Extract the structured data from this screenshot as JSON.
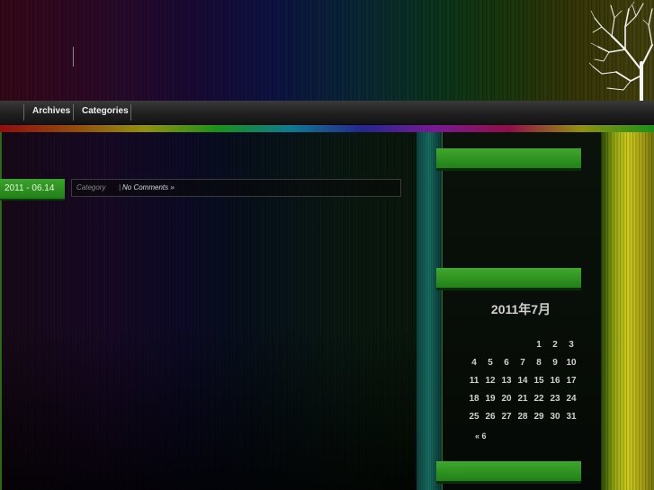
{
  "nav": {
    "archives": "Archives",
    "categories": "Categories"
  },
  "post": {
    "date": "2011 - 06.14",
    "category_label": "Category",
    "separator": "|",
    "comments": "No Comments »"
  },
  "calendar": {
    "caption": "2011年7月",
    "weeks": [
      [
        "",
        "",
        "",
        "",
        "1",
        "2",
        "3"
      ],
      [
        "4",
        "5",
        "6",
        "7",
        "8",
        "9",
        "10"
      ],
      [
        "11",
        "12",
        "13",
        "14",
        "15",
        "16",
        "17"
      ],
      [
        "18",
        "19",
        "20",
        "21",
        "22",
        "23",
        "24"
      ],
      [
        "25",
        "26",
        "27",
        "28",
        "29",
        "30",
        "31"
      ]
    ],
    "prev_link": "« 6"
  },
  "colors": {
    "accent_green": "#3fa82c",
    "text_light": "#d0d0d0"
  }
}
